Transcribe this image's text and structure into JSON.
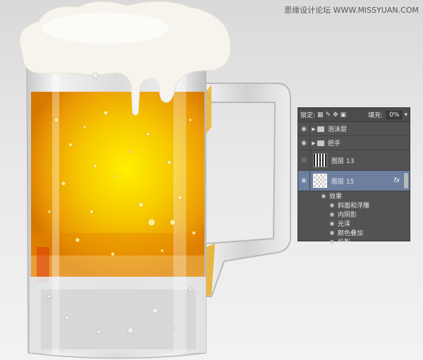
{
  "watermark": "思缘设计论坛 WWW.MISSYUAN.COM",
  "layers_panel": {
    "lock_label": "锁定:",
    "fill_label": "填充:",
    "fill_value": "0%",
    "rows": [
      {
        "name": "泡沫层",
        "type": "group",
        "visible": true
      },
      {
        "name": "把手",
        "type": "group",
        "visible": true
      },
      {
        "name": "图层 13",
        "type": "layer",
        "visible": false
      },
      {
        "name": "图层 15",
        "type": "layer",
        "visible": true,
        "selected": true,
        "fx": "fx"
      }
    ],
    "effects_label": "效果",
    "effects": [
      "斜面和浮雕",
      "内阴影",
      "光泽",
      "颜色叠加",
      "投影"
    ]
  },
  "colors": {
    "beer_center": "#ffe600",
    "beer_edge": "#e08a00",
    "foam": "#f6f4ec",
    "panel_bg": "#535353",
    "selected_row": "#6c7f9f"
  },
  "icons": {
    "eye": "eye-icon",
    "folder": "folder-icon",
    "expand": "triangle-right-icon",
    "lock_pixels": "lock-pixels-icon",
    "lock_paint": "brush-icon",
    "lock_move": "move-icon",
    "lock_all": "lock-icon"
  }
}
